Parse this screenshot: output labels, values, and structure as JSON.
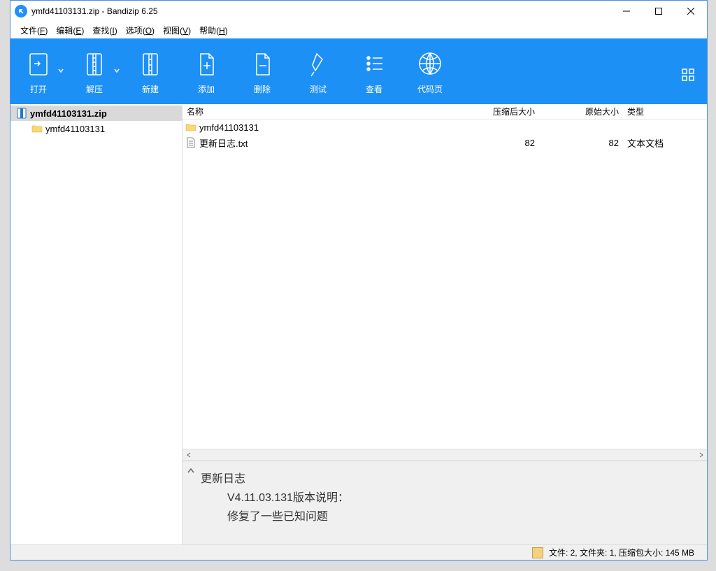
{
  "title": "ymfd41103131.zip - Bandizip 6.25",
  "menu": {
    "file": "文件(F)",
    "edit": "编辑(E)",
    "find": "查找(I)",
    "options": "选项(O)",
    "view": "视图(V)",
    "help": "帮助(H)"
  },
  "toolbar": {
    "open": "打开",
    "extract": "解压",
    "new": "新建",
    "add": "添加",
    "delete": "删除",
    "test": "测试",
    "view": "查看",
    "codepage": "代码页"
  },
  "tree": {
    "root": "ymfd41103131.zip",
    "child": "ymfd41103131"
  },
  "columns": {
    "name": "名称",
    "packed": "压缩后大小",
    "orig": "原始大小",
    "type": "类型"
  },
  "rows": [
    {
      "name": "ymfd41103131",
      "packed": "",
      "orig": "",
      "type": "",
      "icon": "folder"
    },
    {
      "name": "更新日志.txt",
      "packed": "82",
      "orig": "82",
      "type": "文本文档",
      "icon": "txt"
    }
  ],
  "preview": {
    "l1": "更新日志",
    "l2": "V4.11.03.131版本说明：",
    "l3": "修复了一些已知问题"
  },
  "status": "文件: 2, 文件夹: 1, 压缩包大小: 145 MB"
}
